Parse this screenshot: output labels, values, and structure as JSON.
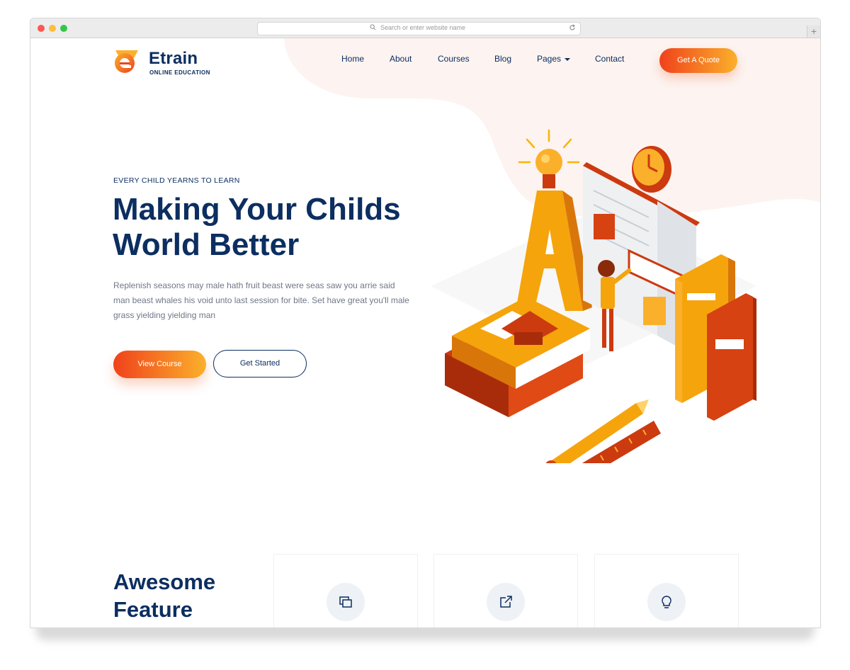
{
  "browser": {
    "address_placeholder": "Search or enter website name"
  },
  "brand": {
    "name": "Etrain",
    "tagline": "ONLINE EDUCATION",
    "logo_letter": "e"
  },
  "nav": {
    "items": [
      {
        "label": "Home"
      },
      {
        "label": "About"
      },
      {
        "label": "Courses"
      },
      {
        "label": "Blog"
      },
      {
        "label": "Pages"
      },
      {
        "label": "Contact"
      }
    ],
    "cta_label": "Get A Quote"
  },
  "hero": {
    "eyebrow": "EVERY CHILD YEARNS TO LEARN",
    "title_line1": "Making Your Childs",
    "title_line2": "World Better",
    "description": "Replenish seasons may male hath fruit beast were seas saw you arrie said man beast whales his void unto last session for bite. Set have great you'll male grass yielding yielding man",
    "primary_button": "View Course",
    "secondary_button": "Get Started"
  },
  "features": {
    "title_line1": "Awesome",
    "title_line2": "Feature",
    "cards": [
      {
        "icon": "layers-icon"
      },
      {
        "icon": "external-link-icon"
      },
      {
        "icon": "lightbulb-icon"
      }
    ]
  },
  "colors": {
    "navy": "#0c2e60",
    "orange_start": "#f0421c",
    "orange_end": "#fbb02b",
    "blob": "#fdf3f0"
  }
}
